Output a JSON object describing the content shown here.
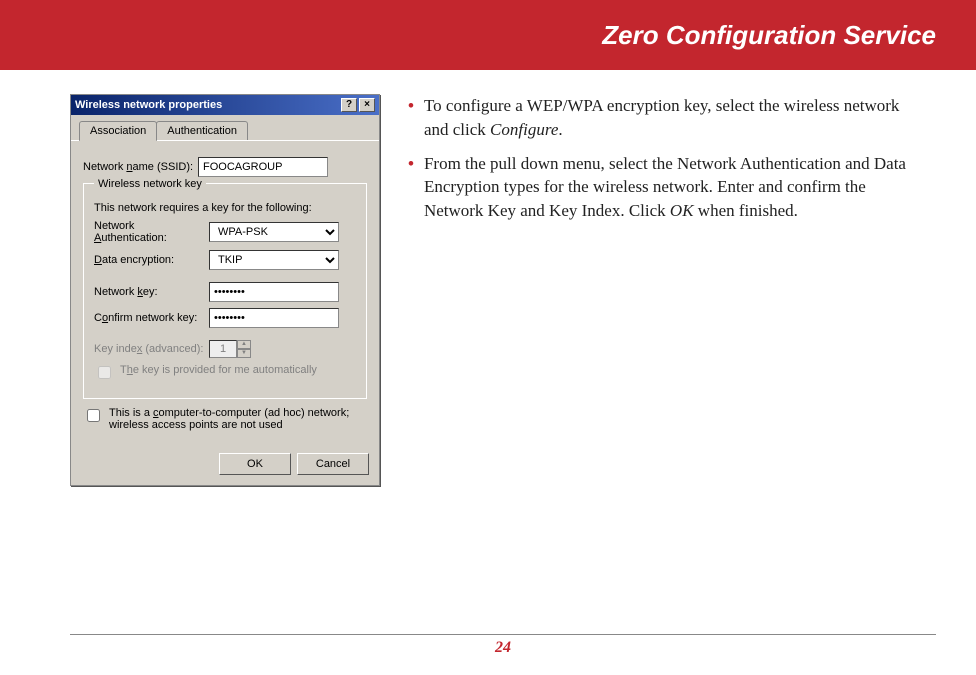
{
  "banner": {
    "title": "Zero Configuration Service"
  },
  "dialog": {
    "title": "Wireless network properties",
    "help_btn": "?",
    "close_btn": "×",
    "tabs": {
      "assoc": "Association",
      "auth": "Authentication"
    },
    "ssid_label_pre": "Network ",
    "ssid_label_u": "n",
    "ssid_label_post": "ame (SSID):",
    "ssid_value": "FOOCAGROUP",
    "group_legend": "Wireless network key",
    "group_desc": "This network requires a key for the following:",
    "auth_label_pre": "Network ",
    "auth_label_u": "A",
    "auth_label_post": "uthentication:",
    "auth_value": "WPA-PSK",
    "enc_label_u": "D",
    "enc_label_post": "ata encryption:",
    "enc_value": "TKIP",
    "key_label_pre": "Network ",
    "key_label_u": "k",
    "key_label_post": "ey:",
    "key_value": "••••••••",
    "confirm_label_pre": "C",
    "confirm_label_u": "o",
    "confirm_label_post": "nfirm network key:",
    "confirm_value": "••••••••",
    "index_label_pre": "Key inde",
    "index_label_u": "x",
    "index_label_post": " (advanced):",
    "index_value": "1",
    "auto_key_pre": "T",
    "auto_key_u": "h",
    "auto_key_post": "e key is provided for me automatically",
    "adhoc_pre": "This is a ",
    "adhoc_u": "c",
    "adhoc_post": "omputer-to-computer (ad hoc) network; wireless access points are not used",
    "ok": "OK",
    "cancel": "Cancel"
  },
  "instructions": {
    "b1_pre": "To configure a WEP/WPA encryption key, select the wireless network and click ",
    "b1_em": "Configure",
    "b1_post": ".",
    "b2_pre": "From the pull down menu, select the Network Authentication and Data Encryption types for the wireless network.  Enter and confirm the Network Key and Key Index.  Click ",
    "b2_em": "OK",
    "b2_post": " when finished."
  },
  "page_number": "24"
}
